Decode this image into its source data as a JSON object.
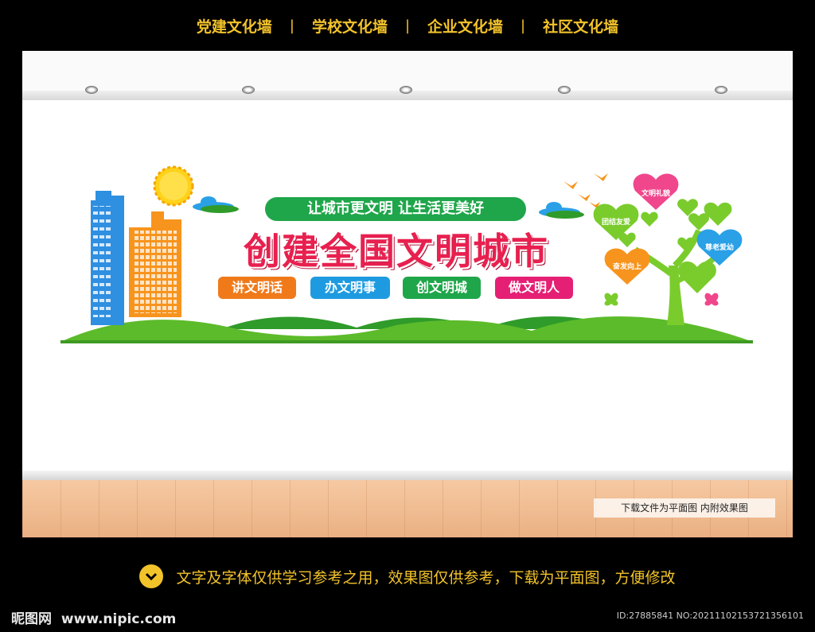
{
  "nav": {
    "items": [
      "党建文化墙",
      "学校文化墙",
      "企业文化墙",
      "社区文化墙"
    ],
    "separator": "|"
  },
  "banner": {
    "slogan": "让城市更文明  让生活更美好",
    "title": "创建全国文明城市",
    "tags": [
      {
        "label": "讲文明话",
        "color": "#f07a1a"
      },
      {
        "label": "办文明事",
        "color": "#1e9be0"
      },
      {
        "label": "创文明城",
        "color": "#1fa64a"
      },
      {
        "label": "做文明人",
        "color": "#e51f74"
      }
    ],
    "hearts": [
      {
        "label": "文明礼貌",
        "color": "#f0468c"
      },
      {
        "label": "团结友爱",
        "color": "#7acc2c"
      },
      {
        "label": "尊老爱幼",
        "color": "#2aa0e6"
      },
      {
        "label": "奋发向上",
        "color": "#f7941d"
      }
    ],
    "colors": {
      "grass": "#5cbb2a",
      "grass_dark": "#2f9b2a",
      "building_blue": "#2f8fe0",
      "building_orange": "#f7941d",
      "sun": "#ffd21a"
    }
  },
  "watermark_note": "下载文件为平面图  内附效果图",
  "footer": {
    "notice": "文字及字体仅供学习参考之用，效果图仅供参考，下载为平面图，方便修改",
    "logo_cn": "昵图网",
    "logo_url": "www.nipic.com",
    "image_id": "ID:27885841 NO:20211102153721356101"
  }
}
